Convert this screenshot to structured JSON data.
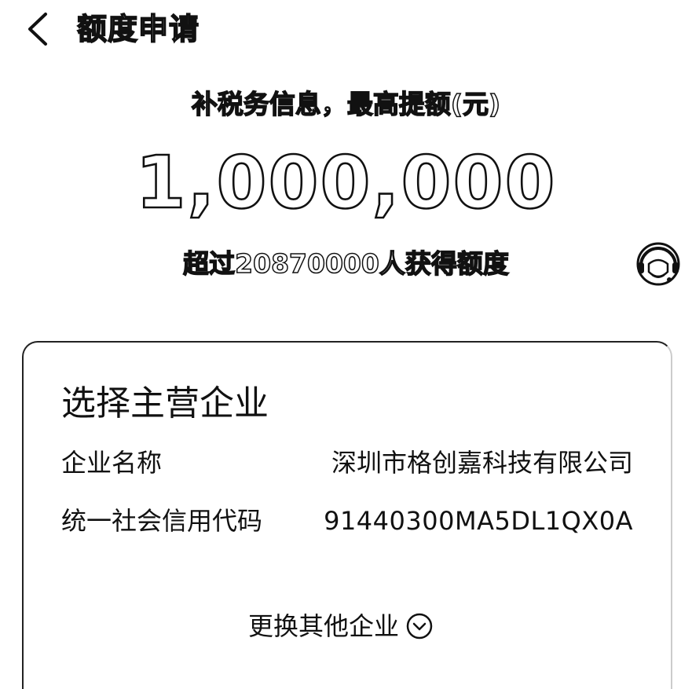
{
  "header": {
    "title": "额度申请",
    "back_icon": "chevron-left-icon"
  },
  "hero": {
    "subtitle": "补税务信息，最高提额(元)",
    "amount": "1,000,000",
    "stats": "超过20870000人获得额度",
    "service_icon": "customer-service-icon"
  },
  "card": {
    "title": "选择主营企业",
    "fields": [
      {
        "label": "企业名称",
        "value": "深圳市格创嘉科技有限公司"
      },
      {
        "label": "统一社会信用代码",
        "value": "91440300MA5DL1QX0A"
      }
    ],
    "switch_label": "更换其他企业",
    "switch_icon": "chevron-down-circle-icon"
  }
}
